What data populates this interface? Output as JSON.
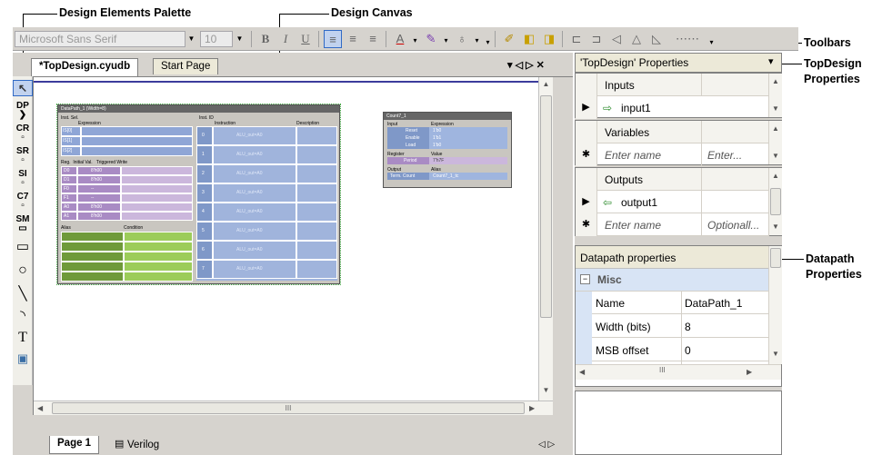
{
  "annotations": {
    "palette": "Design Elements Palette",
    "canvas": "Design Canvas",
    "toolbars": "Toolbars",
    "topdesign_props": "TopDesign\nProperties",
    "topdesign_line1": "TopDesign",
    "topdesign_line2": "Properties",
    "datapath_line1": "Datapath",
    "datapath_line2": "Properties"
  },
  "toolbar": {
    "font": "Microsoft Sans Serif",
    "size": "10",
    "bold": "B",
    "italic": "I",
    "underline": "U"
  },
  "tabs": {
    "design": "*TopDesign.cyudb",
    "start": "Start Page",
    "page1": "Page 1",
    "verilog": "Verilog"
  },
  "palette": {
    "items": [
      "DP",
      "CR",
      "SR",
      "SI",
      "C7",
      "SM"
    ]
  },
  "canvas": {
    "datapath": {
      "title": "DataPath_1 (Width=8)",
      "headers": [
        "Inst. Sel.",
        "Expression",
        "Inst. ID",
        "Instruction",
        "Description"
      ],
      "sel_rows": [
        "IS[0]",
        "IS[1]",
        "IS[2]"
      ],
      "reg_headers": [
        "Reg.",
        "Initial Val.",
        "Triggered Write"
      ],
      "regs": [
        [
          "D0",
          "8'h00"
        ],
        [
          "D1",
          "8'h00"
        ],
        [
          "F0",
          "--"
        ],
        [
          "F1",
          "--"
        ],
        [
          "A0",
          "8'h00"
        ],
        [
          "A1",
          "8'h00"
        ]
      ],
      "alias_headers": [
        "Alias",
        "Condition"
      ],
      "ids": [
        "0",
        "1",
        "2",
        "3",
        "4",
        "5",
        "6",
        "7"
      ],
      "instr": "ALU_out=A0"
    },
    "count7": {
      "title": "Count7_1",
      "headers": [
        "Input",
        "Expression"
      ],
      "inputs": [
        [
          "Reset",
          "1'b0"
        ],
        [
          "Enable",
          "1'b1"
        ],
        [
          "Load",
          "1'b0"
        ]
      ],
      "reg_headers": [
        "Register",
        "Value"
      ],
      "reg": [
        "Period",
        "7'h7F"
      ],
      "out_headers": [
        "Output",
        "Alias"
      ],
      "out": [
        "Term. Count",
        "Count7_1_tc"
      ]
    }
  },
  "hscroll_label": "III",
  "doc_controls": "▾ ◁ ▷ ✕",
  "bottom_controls": "◁ ▷",
  "right": {
    "title": "'TopDesign' Properties",
    "pin": "▾",
    "inputs_header": "Inputs",
    "input1": "input1",
    "variables_header": "Variables",
    "var_name_ph": "Enter name",
    "var_val_ph": "Enter...",
    "outputs_header": "Outputs",
    "output1": "output1",
    "out_name_ph": "Enter name",
    "out_val_ph": "Optionall...",
    "dp_title": "Datapath properties",
    "misc": "Misc",
    "props": [
      {
        "name": "Name",
        "value": "DataPath_1"
      },
      {
        "name": "Width (bits)",
        "value": "8"
      },
      {
        "name": "MSB offset",
        "value": "0"
      }
    ],
    "scroll_label": "III"
  }
}
